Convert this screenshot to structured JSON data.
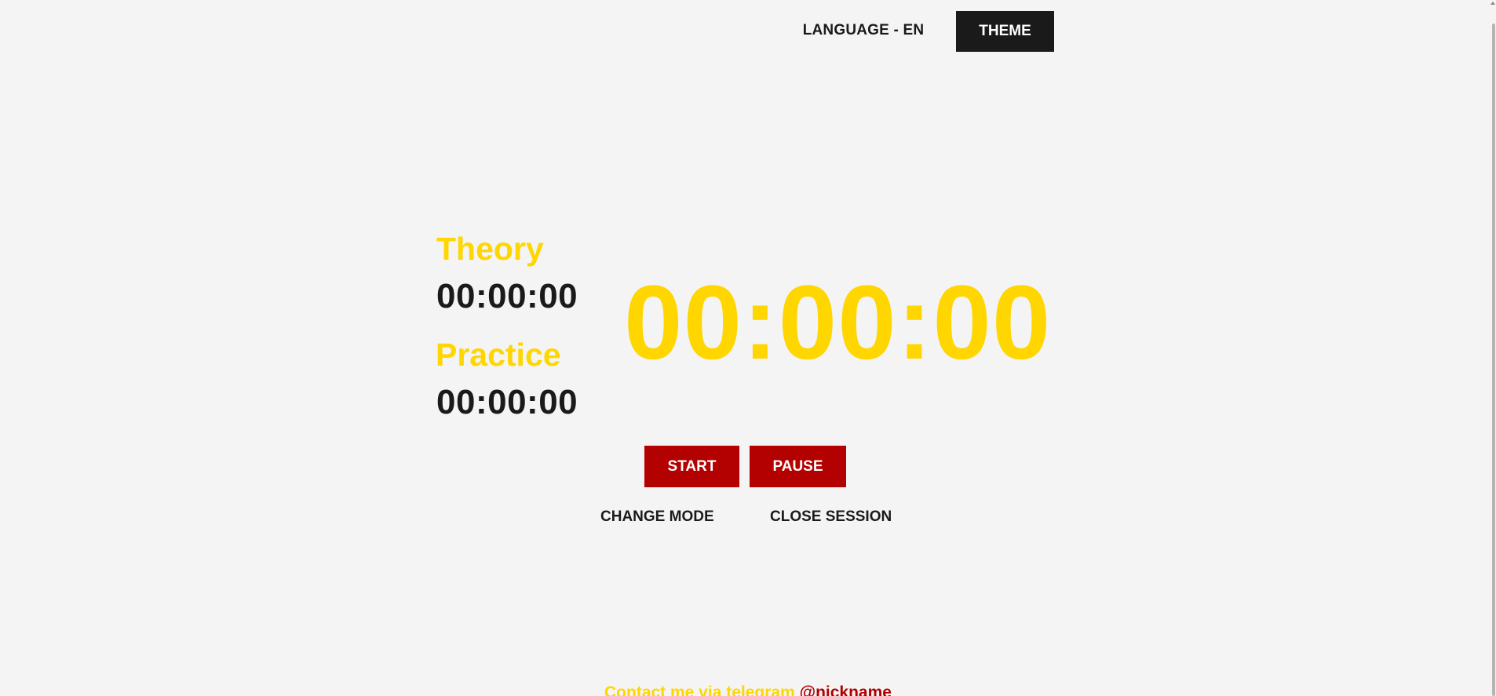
{
  "header": {
    "language_label": "LANGUAGE - EN",
    "theme_label": "THEME"
  },
  "timers": {
    "theory_label": "Theory",
    "theory_time": "00:00:00",
    "practice_label": "Practice",
    "practice_time": "00:00:00",
    "main_time": "00:00:00"
  },
  "actions": {
    "start_label": "START",
    "pause_label": "PAUSE",
    "change_mode_label": "CHANGE MODE",
    "close_session_label": "CLOSE SESSION"
  },
  "footer": {
    "contact_text": "Contact me via telegram",
    "nickname": "@nickname"
  },
  "colors": {
    "background": "#f4f4f4",
    "accent_yellow": "#ffd600",
    "accent_red": "#b30000",
    "dark": "#1a1a1a"
  }
}
